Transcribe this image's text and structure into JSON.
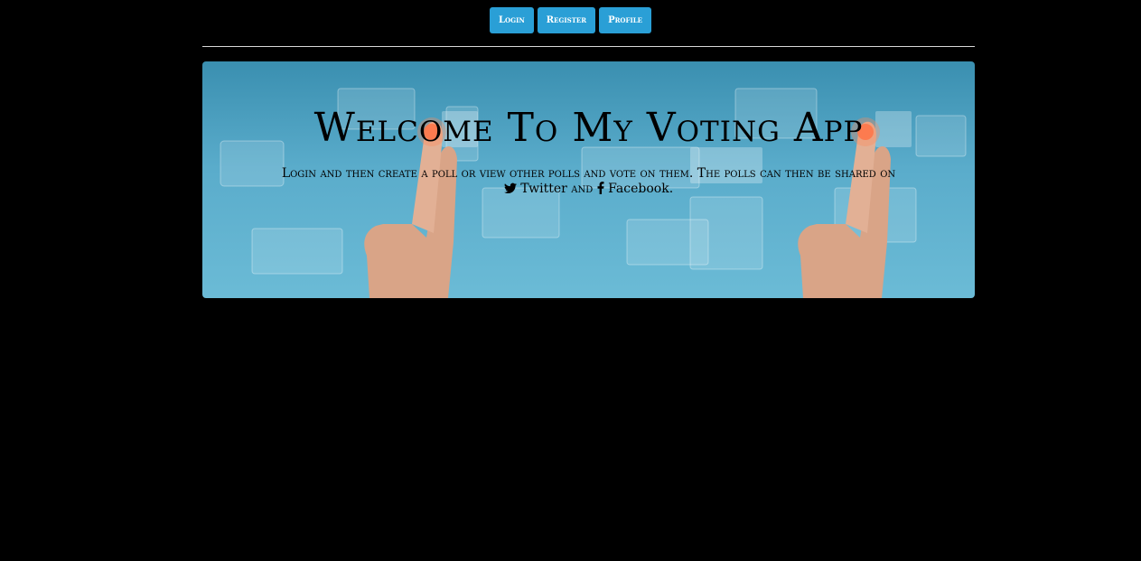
{
  "nav": {
    "login_label": "Login",
    "register_label": "Register",
    "profile_label": "Profile"
  },
  "hero": {
    "title": "Welcome To My Voting App",
    "text_line1": "Login and then create a poll or view other polls and vote on them. The polls can then be shared on",
    "twitter_label": "Twitter",
    "and_label": "and",
    "facebook_label": "Facebook."
  },
  "icons": {
    "twitter": "twitter-icon",
    "facebook": "facebook-icon"
  },
  "colors": {
    "button": "#2a9fd6",
    "page_background": "#000000",
    "hero": "#5aaccb"
  }
}
